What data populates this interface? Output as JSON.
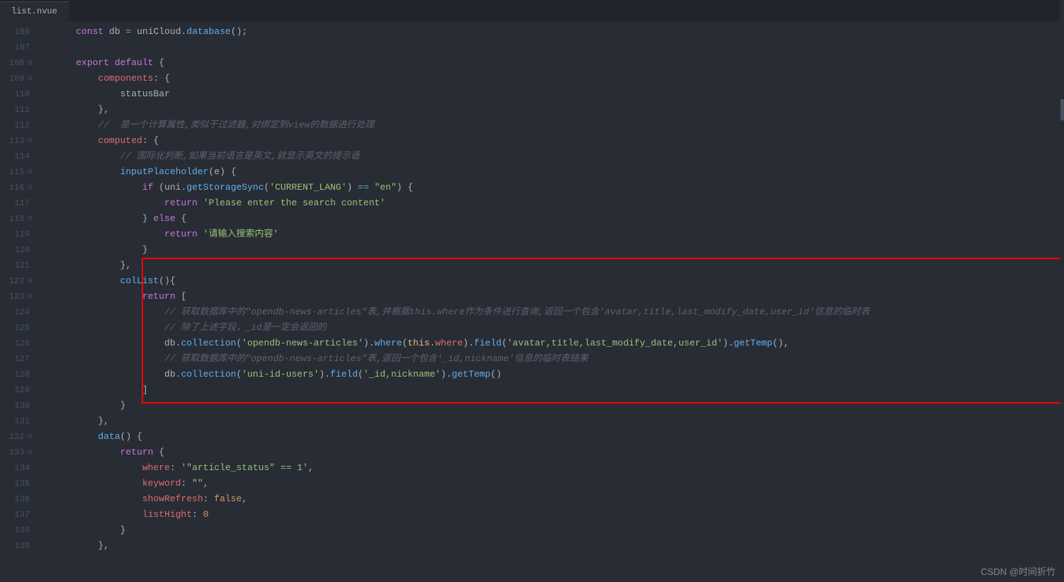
{
  "tab": {
    "filename": "list.nvue"
  },
  "watermark": "CSDN @时间折竹",
  "lines": [
    {
      "num": "106",
      "fold": "",
      "tokens": [
        [
          "    ",
          ""
        ],
        [
          "const",
          "kw-purple"
        ],
        [
          " ",
          ""
        ],
        [
          "db",
          "ident"
        ],
        [
          " ",
          ""
        ],
        [
          "=",
          "op"
        ],
        [
          " ",
          ""
        ],
        [
          "uniCloud",
          "ident"
        ],
        [
          ".",
          "punct"
        ],
        [
          "database",
          "func"
        ],
        [
          "(",
          "paren"
        ],
        [
          ")",
          "paren"
        ],
        [
          ";",
          "punct"
        ]
      ]
    },
    {
      "num": "107",
      "fold": "",
      "tokens": []
    },
    {
      "num": "108",
      "fold": "⊟",
      "tokens": [
        [
          "    ",
          ""
        ],
        [
          "export",
          "kw-purple"
        ],
        [
          " ",
          ""
        ],
        [
          "default",
          "kw-purple"
        ],
        [
          " ",
          ""
        ],
        [
          "{",
          "punct"
        ]
      ]
    },
    {
      "num": "109",
      "fold": "⊟",
      "tokens": [
        [
          "        ",
          ""
        ],
        [
          "components",
          "prop"
        ],
        [
          ":",
          "punct"
        ],
        [
          " ",
          ""
        ],
        [
          "{",
          "punct"
        ]
      ]
    },
    {
      "num": "110",
      "fold": "",
      "tokens": [
        [
          "            ",
          ""
        ],
        [
          "statusBar",
          "ident"
        ]
      ]
    },
    {
      "num": "111",
      "fold": "",
      "tokens": [
        [
          "        ",
          ""
        ],
        [
          "}",
          "punct"
        ],
        [
          ",",
          "punct"
        ]
      ]
    },
    {
      "num": "112",
      "fold": "",
      "tokens": [
        [
          "        ",
          ""
        ],
        [
          "//  是一个计算属性,类似于过滤器,对绑定到view的数据进行处理",
          "comment"
        ]
      ]
    },
    {
      "num": "113",
      "fold": "⊟",
      "tokens": [
        [
          "        ",
          ""
        ],
        [
          "computed",
          "prop"
        ],
        [
          ":",
          "punct"
        ],
        [
          " ",
          ""
        ],
        [
          "{",
          "punct"
        ]
      ]
    },
    {
      "num": "114",
      "fold": "",
      "tokens": [
        [
          "            ",
          ""
        ],
        [
          "// 国际化判断,如果当前语言是英文,就显示英文的提示语",
          "comment"
        ]
      ]
    },
    {
      "num": "115",
      "fold": "⊟",
      "tokens": [
        [
          "            ",
          ""
        ],
        [
          "inputPlaceholder",
          "func"
        ],
        [
          "(",
          "paren"
        ],
        [
          "e",
          "ident"
        ],
        [
          ")",
          "paren"
        ],
        [
          " ",
          ""
        ],
        [
          "{",
          "punct"
        ]
      ]
    },
    {
      "num": "116",
      "fold": "⊟",
      "tokens": [
        [
          "                ",
          ""
        ],
        [
          "if",
          "kw-purple"
        ],
        [
          " ",
          ""
        ],
        [
          "(",
          "paren"
        ],
        [
          "uni",
          "ident"
        ],
        [
          ".",
          "punct"
        ],
        [
          "getStorageSync",
          "func"
        ],
        [
          "(",
          "paren"
        ],
        [
          "'CURRENT_LANG'",
          "str"
        ],
        [
          ")",
          "paren"
        ],
        [
          " ",
          ""
        ],
        [
          "==",
          "op"
        ],
        [
          " ",
          ""
        ],
        [
          "\"en\"",
          "str"
        ],
        [
          ")",
          "paren"
        ],
        [
          " ",
          ""
        ],
        [
          "{",
          "punct"
        ]
      ]
    },
    {
      "num": "117",
      "fold": "",
      "tokens": [
        [
          "                    ",
          ""
        ],
        [
          "return",
          "kw-purple"
        ],
        [
          " ",
          ""
        ],
        [
          "'Please enter the search content'",
          "str"
        ]
      ]
    },
    {
      "num": "118",
      "fold": "⊟",
      "tokens": [
        [
          "                ",
          ""
        ],
        [
          "}",
          "punct"
        ],
        [
          " ",
          ""
        ],
        [
          "else",
          "kw-purple"
        ],
        [
          " ",
          ""
        ],
        [
          "{",
          "punct"
        ]
      ]
    },
    {
      "num": "119",
      "fold": "",
      "tokens": [
        [
          "                    ",
          ""
        ],
        [
          "return",
          "kw-purple"
        ],
        [
          " ",
          ""
        ],
        [
          "'请输入搜索内容'",
          "str"
        ]
      ]
    },
    {
      "num": "120",
      "fold": "",
      "tokens": [
        [
          "                ",
          ""
        ],
        [
          "}",
          "punct"
        ]
      ]
    },
    {
      "num": "121",
      "fold": "",
      "tokens": [
        [
          "            ",
          ""
        ],
        [
          "}",
          "punct"
        ],
        [
          ",",
          "punct"
        ]
      ]
    },
    {
      "num": "122",
      "fold": "⊟",
      "tokens": [
        [
          "            ",
          ""
        ],
        [
          "colList",
          "func"
        ],
        [
          "(",
          "paren"
        ],
        [
          ")",
          "paren"
        ],
        [
          "{",
          "punct"
        ]
      ]
    },
    {
      "num": "123",
      "fold": "⊟",
      "tokens": [
        [
          "                ",
          ""
        ],
        [
          "return",
          "kw-purple"
        ],
        [
          " ",
          ""
        ],
        [
          "[",
          "punct"
        ]
      ]
    },
    {
      "num": "124",
      "fold": "",
      "tokens": [
        [
          "                    ",
          ""
        ],
        [
          "// 获取数据库中的\"opendb-news-articles\"表,并根据this.where作为条件进行查询,返回一个包含'avatar,title,last_modify_date,user_id'信息的临时表",
          "comment"
        ]
      ]
    },
    {
      "num": "125",
      "fold": "",
      "tokens": [
        [
          "                    ",
          ""
        ],
        [
          "// 除了上述字段，_id是一定会返回的",
          "comment"
        ]
      ]
    },
    {
      "num": "126",
      "fold": "",
      "tokens": [
        [
          "                    ",
          ""
        ],
        [
          "db",
          "ident"
        ],
        [
          ".",
          "punct"
        ],
        [
          "collection",
          "func"
        ],
        [
          "(",
          "paren"
        ],
        [
          "'opendb-news-articles'",
          "str"
        ],
        [
          ")",
          "paren"
        ],
        [
          ".",
          "punct"
        ],
        [
          "where",
          "func"
        ],
        [
          "(",
          "paren"
        ],
        [
          "this",
          "this-kw"
        ],
        [
          ".",
          "punct"
        ],
        [
          "where",
          "prop"
        ],
        [
          ")",
          "paren"
        ],
        [
          ".",
          "punct"
        ],
        [
          "field",
          "func"
        ],
        [
          "(",
          "paren"
        ],
        [
          "'avatar,title,last_modify_date,user_id'",
          "str"
        ],
        [
          ")",
          "paren"
        ],
        [
          ".",
          "punct"
        ],
        [
          "getTemp",
          "func"
        ],
        [
          "(",
          "paren"
        ],
        [
          ")",
          "paren"
        ],
        [
          ",",
          "punct"
        ]
      ]
    },
    {
      "num": "127",
      "fold": "",
      "tokens": [
        [
          "                    ",
          ""
        ],
        [
          "// 获取数据库中的\"opendb-news-articles\"表,返回一个包含'_id,nickname'信息的临时表结果",
          "comment"
        ]
      ]
    },
    {
      "num": "128",
      "fold": "",
      "tokens": [
        [
          "                    ",
          ""
        ],
        [
          "db",
          "ident"
        ],
        [
          ".",
          "punct"
        ],
        [
          "collection",
          "func"
        ],
        [
          "(",
          "paren"
        ],
        [
          "'uni-id-users'",
          "str"
        ],
        [
          ")",
          "paren"
        ],
        [
          ".",
          "punct"
        ],
        [
          "field",
          "func"
        ],
        [
          "(",
          "paren"
        ],
        [
          "'_id,nickname'",
          "str"
        ],
        [
          ")",
          "paren"
        ],
        [
          ".",
          "punct"
        ],
        [
          "getTemp",
          "func"
        ],
        [
          "(",
          "paren"
        ],
        [
          ")",
          "paren"
        ]
      ]
    },
    {
      "num": "129",
      "fold": "",
      "tokens": [
        [
          "                ",
          ""
        ],
        [
          "]",
          "punct"
        ]
      ]
    },
    {
      "num": "130",
      "fold": "",
      "tokens": [
        [
          "            ",
          ""
        ],
        [
          "}",
          "punct"
        ]
      ]
    },
    {
      "num": "131",
      "fold": "",
      "tokens": [
        [
          "        ",
          ""
        ],
        [
          "}",
          "punct"
        ],
        [
          ",",
          "punct"
        ]
      ]
    },
    {
      "num": "132",
      "fold": "⊟",
      "tokens": [
        [
          "        ",
          ""
        ],
        [
          "data",
          "func"
        ],
        [
          "(",
          "paren"
        ],
        [
          ")",
          "paren"
        ],
        [
          " ",
          ""
        ],
        [
          "{",
          "punct"
        ]
      ]
    },
    {
      "num": "133",
      "fold": "⊟",
      "tokens": [
        [
          "            ",
          ""
        ],
        [
          "return",
          "kw-purple"
        ],
        [
          " ",
          ""
        ],
        [
          "{",
          "punct"
        ]
      ]
    },
    {
      "num": "134",
      "fold": "",
      "tokens": [
        [
          "                ",
          ""
        ],
        [
          "where",
          "prop"
        ],
        [
          ":",
          "punct"
        ],
        [
          " ",
          ""
        ],
        [
          "'\"article_status\" == 1'",
          "str"
        ],
        [
          ",",
          "punct"
        ]
      ]
    },
    {
      "num": "135",
      "fold": "",
      "tokens": [
        [
          "                ",
          ""
        ],
        [
          "keyword",
          "prop"
        ],
        [
          ":",
          "punct"
        ],
        [
          " ",
          ""
        ],
        [
          "\"\"",
          "str"
        ],
        [
          ",",
          "punct"
        ]
      ]
    },
    {
      "num": "136",
      "fold": "",
      "tokens": [
        [
          "                ",
          ""
        ],
        [
          "showRefresh",
          "prop"
        ],
        [
          ":",
          "punct"
        ],
        [
          " ",
          ""
        ],
        [
          "false",
          "bool"
        ],
        [
          ",",
          "punct"
        ]
      ]
    },
    {
      "num": "137",
      "fold": "",
      "tokens": [
        [
          "                ",
          ""
        ],
        [
          "listHight",
          "prop"
        ],
        [
          ":",
          "punct"
        ],
        [
          " ",
          ""
        ],
        [
          "0",
          "num"
        ]
      ]
    },
    {
      "num": "138",
      "fold": "",
      "tokens": [
        [
          "            ",
          ""
        ],
        [
          "}",
          "punct"
        ]
      ]
    },
    {
      "num": "139",
      "fold": "",
      "tokens": [
        [
          "        ",
          ""
        ],
        [
          "}",
          "punct"
        ],
        [
          ",",
          "punct"
        ]
      ]
    }
  ]
}
